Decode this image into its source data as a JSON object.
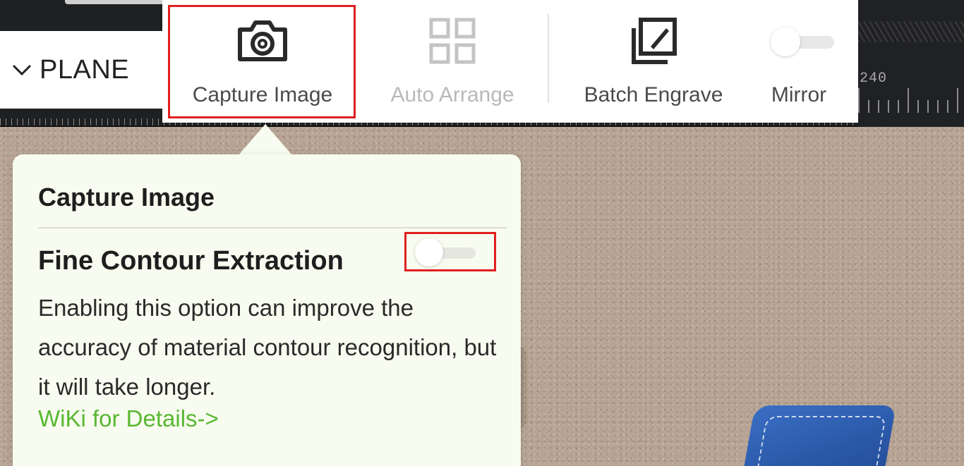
{
  "header": {
    "plane_label": "PLANE",
    "ruler_number": "240"
  },
  "toolbar": {
    "capture_label": "Capture Image",
    "arrange_label": "Auto Arrange",
    "batch_label": "Batch Engrave",
    "mirror_label": "Mirror",
    "mirror_on": false,
    "arrange_disabled": true
  },
  "popover": {
    "title": "Capture Image",
    "option_label": "Fine Contour Extraction",
    "option_on": false,
    "description": "Enabling this option can improve the accuracy of material contour recognition, but it will take longer.",
    "link_text": "WiKi for Details->"
  },
  "colors": {
    "highlight_frame": "#e02020",
    "link": "#59b832",
    "popover_bg": "#f8fbef",
    "disabled_text": "#b9b9b9"
  }
}
